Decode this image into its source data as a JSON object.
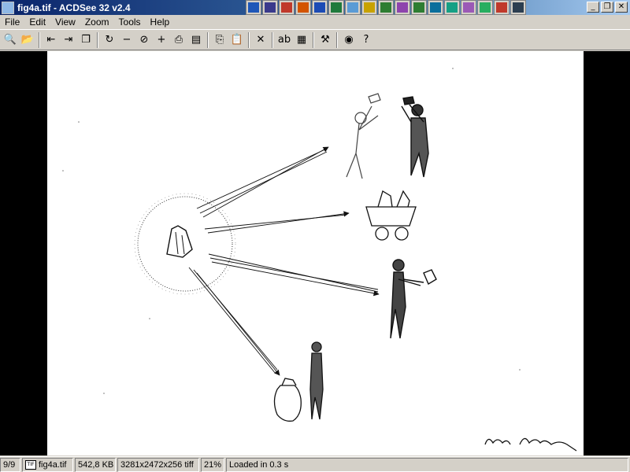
{
  "window": {
    "title": "fig4a.tif - ACDSee 32 v2.4"
  },
  "taskbar_apps": [
    {
      "name": "app-1",
      "color": "#1f57b8"
    },
    {
      "name": "app-2",
      "color": "#3a3a8c"
    },
    {
      "name": "app-3",
      "color": "#c0392b"
    },
    {
      "name": "app-4",
      "color": "#d35400"
    },
    {
      "name": "word",
      "color": "#1c4bb5"
    },
    {
      "name": "excel",
      "color": "#1f7a3c"
    },
    {
      "name": "app-7",
      "color": "#5a9bd5"
    },
    {
      "name": "app-8",
      "color": "#c8a200"
    },
    {
      "name": "app-9",
      "color": "#2e7d32"
    },
    {
      "name": "app-10",
      "color": "#8e44ad"
    },
    {
      "name": "app-11",
      "color": "#2e7d32"
    },
    {
      "name": "app-12",
      "color": "#0a6e9c"
    },
    {
      "name": "app-13",
      "color": "#16a085"
    },
    {
      "name": "app-14",
      "color": "#9b59b6"
    },
    {
      "name": "app-15",
      "color": "#27ae60"
    },
    {
      "name": "app-16",
      "color": "#c0392b"
    },
    {
      "name": "app-17",
      "color": "#2c3e50"
    }
  ],
  "menu": [
    "File",
    "Edit",
    "View",
    "Zoom",
    "Tools",
    "Help"
  ],
  "toolbar": [
    {
      "icon": "browse-icon",
      "glyph": "🔍"
    },
    {
      "icon": "open-folder-icon",
      "glyph": "📂"
    },
    {
      "sep": true
    },
    {
      "icon": "previous-icon",
      "glyph": "⇤"
    },
    {
      "icon": "next-icon",
      "glyph": "⇥"
    },
    {
      "icon": "copy-window-icon",
      "glyph": "❐"
    },
    {
      "sep": true
    },
    {
      "icon": "rotate-icon",
      "glyph": "↻"
    },
    {
      "icon": "zoom-out-icon",
      "glyph": "−"
    },
    {
      "icon": "zoom-fit-icon",
      "glyph": "⊘"
    },
    {
      "icon": "zoom-in-icon",
      "glyph": "+"
    },
    {
      "icon": "print-icon",
      "glyph": "⎙"
    },
    {
      "icon": "scan-icon",
      "glyph": "▤"
    },
    {
      "sep": true
    },
    {
      "icon": "copy-icon",
      "glyph": "⎘"
    },
    {
      "icon": "paste-icon",
      "glyph": "📋"
    },
    {
      "sep": true
    },
    {
      "icon": "delete-icon",
      "glyph": "✕"
    },
    {
      "sep": true
    },
    {
      "icon": "rename-icon",
      "glyph": "ab"
    },
    {
      "icon": "properties-icon",
      "glyph": "▦"
    },
    {
      "sep": true
    },
    {
      "icon": "tools-icon",
      "glyph": "⚒"
    },
    {
      "sep": true
    },
    {
      "icon": "view-icon",
      "glyph": "◉"
    },
    {
      "icon": "help-icon",
      "glyph": "?"
    }
  ],
  "status": {
    "position": "9/9",
    "filename": "fig4a.tif",
    "filesize": "542,8 KB",
    "dimensions": "3281x2472x256 tiff",
    "zoom": "21%",
    "load_time": "Loaded in 0.3 s"
  }
}
